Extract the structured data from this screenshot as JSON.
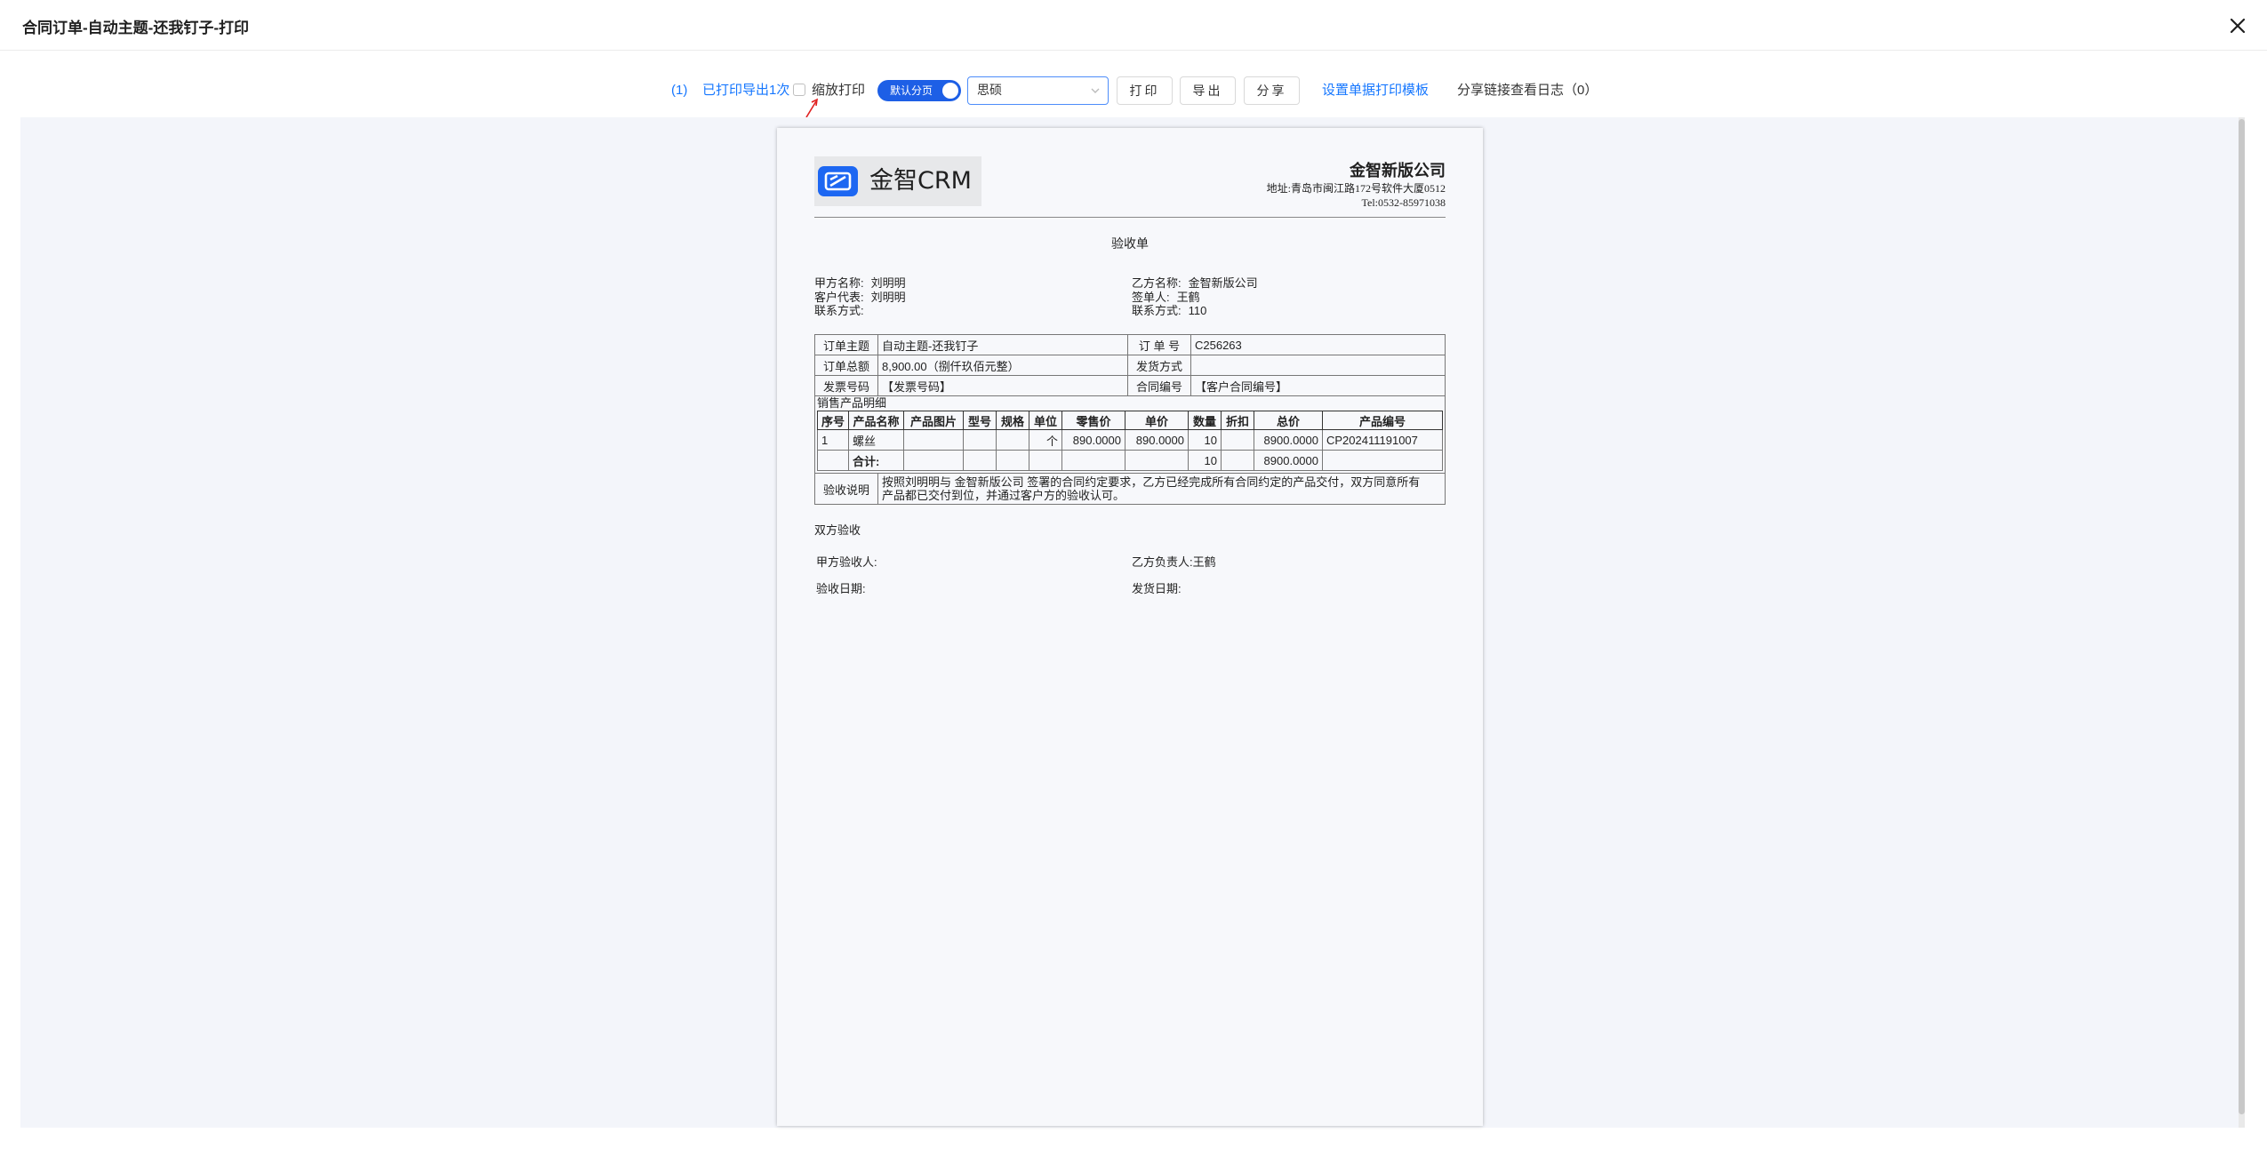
{
  "window": {
    "title": "合同订单-自动主题-还我钉子-打印"
  },
  "toolbar": {
    "page_count": "(1)",
    "print_status": "已打印导出1次",
    "scale_print_label": "缩放打印",
    "scale_print_checked": false,
    "pagination_toggle": "默认分页",
    "template_select_value": "思硕",
    "print_button": "打印",
    "export_button": "导出",
    "share_button": "分享",
    "template_link": "设置单据打印模板",
    "share_log_link": "分享链接查看日志（0）"
  },
  "document": {
    "logo_text": "金智CRM",
    "company_name": "金智新版公司",
    "company_address": "地址:青岛市闽江路172号软件大厦0512",
    "company_tel": "Tel:0532-85971038",
    "doc_title": "验收单",
    "party_a_name_label": "甲方名称:",
    "party_a_name": "刘明明",
    "party_a_rep_label": "客户代表:",
    "party_a_rep": "刘明明",
    "party_a_contact_label": "联系方式:",
    "party_a_contact": "",
    "party_b_name_label": "乙方名称:",
    "party_b_name": "金智新版公司",
    "party_b_signer_label": "签单人:",
    "party_b_signer": "王鹤",
    "party_b_contact_label": "联系方式:",
    "party_b_contact": "110",
    "order_subject_label": "订单主题",
    "order_subject": "自动主题-还我钉子",
    "order_no_label": "订 单 号",
    "order_no": "C256263",
    "order_total_label": "订单总额",
    "order_total": "8,900.00（捌仟玖佰元整）",
    "shipping_label": "发货方式",
    "shipping": "",
    "invoice_label": "发票号码",
    "invoice": "【发票号码】",
    "contract_no_label": "合同编号",
    "contract_no": "【客户合同编号】",
    "product_section_label": "销售产品明细",
    "product_headers": [
      "序号",
      "产品名称",
      "产品图片",
      "型号",
      "规格",
      "单位",
      "零售价",
      "单价",
      "数量",
      "折扣",
      "总价",
      "产品编号"
    ],
    "product_row": {
      "idx": "1",
      "name": "螺丝",
      "image": "",
      "model": "",
      "spec": "",
      "unit": "个",
      "retail": "890.0000",
      "price": "890.0000",
      "qty": "10",
      "discount": "",
      "total": "8900.0000",
      "code": "CP202411191007"
    },
    "total_row": {
      "label": "合计:",
      "qty": "10",
      "total": "8900.0000"
    },
    "acceptance_label": "验收说明",
    "acceptance_text_1": "按照刘明明与 金智新版公司 签署的合同约定要求，乙方已经完成所有合同约定的产品交付，双方同意所有",
    "acceptance_text_2": "产品都已交付到位，并通过客户方的验收认可。",
    "both_accept": "双方验收",
    "party_a_acceptor_label": "甲方验收人:",
    "party_a_acceptor": "",
    "party_b_owner_label": "乙方负责人:",
    "party_b_owner": "王鹤",
    "accept_date_label": "验收日期:",
    "accept_date": "",
    "ship_date_label": "发货日期:",
    "ship_date": ""
  },
  "colors": {
    "accent": "#1677ff",
    "toggle": "#1d5fe6",
    "preview_bg": "#f3f5fa"
  }
}
